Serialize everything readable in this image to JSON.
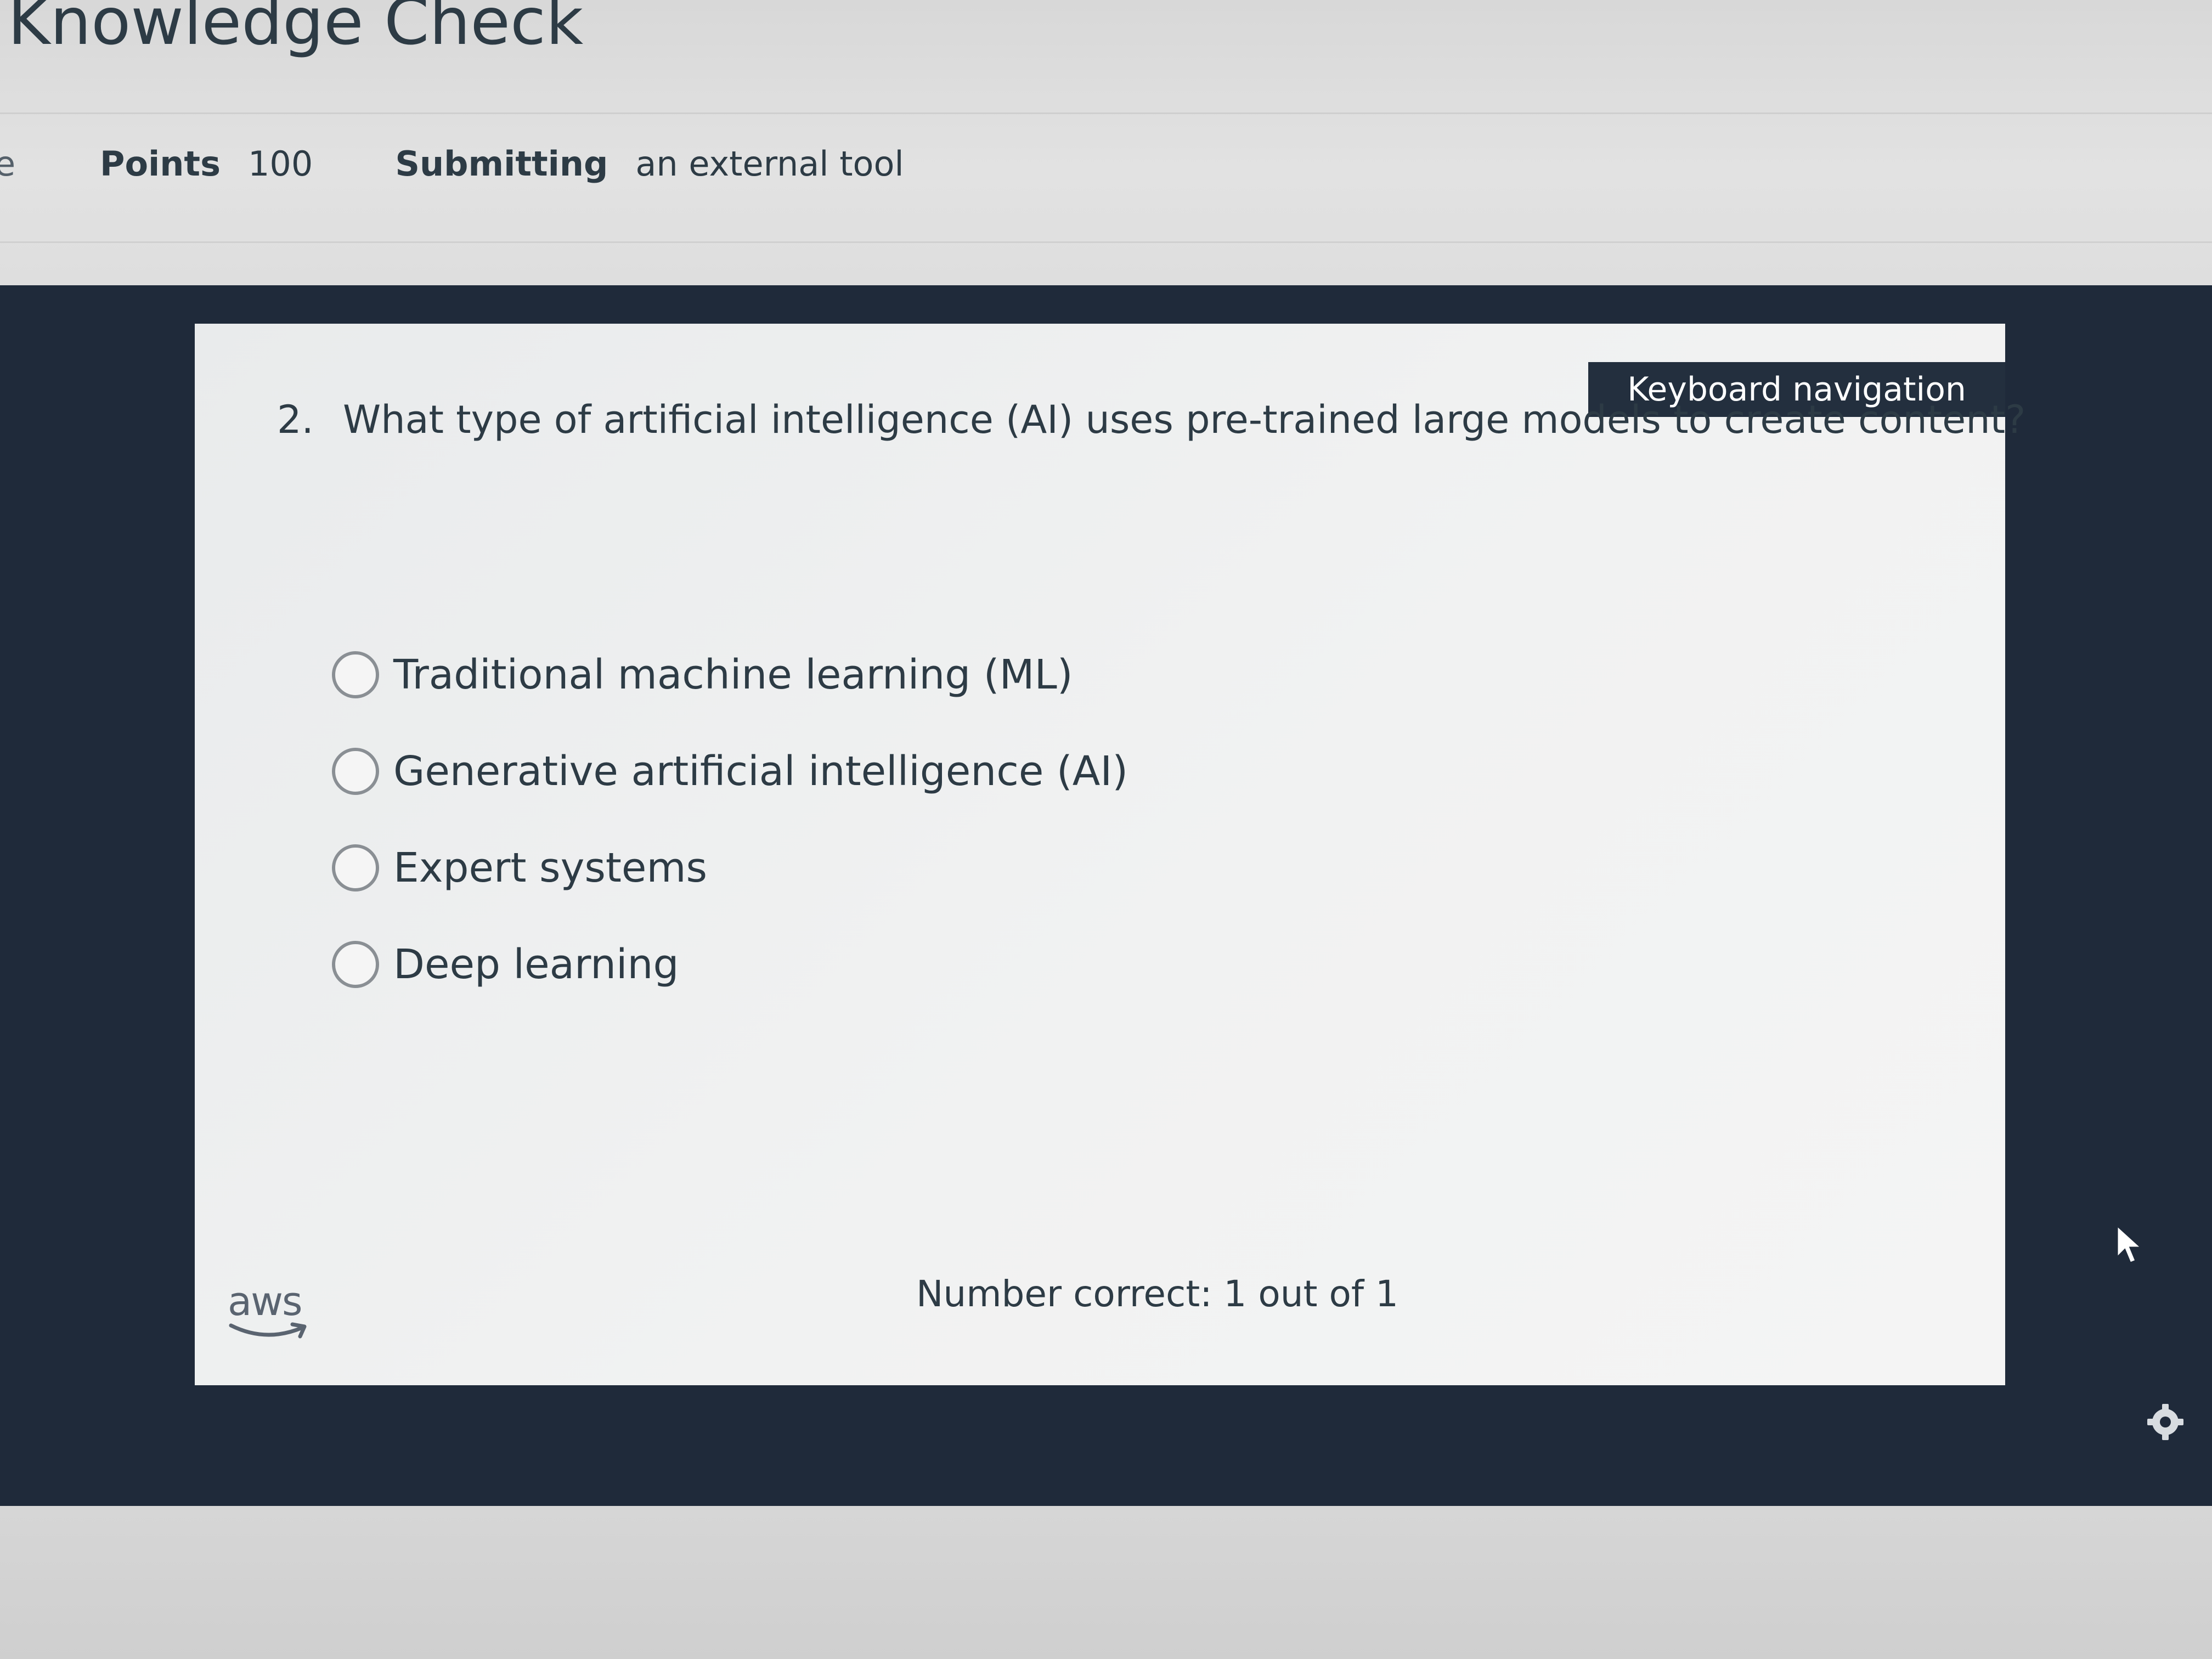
{
  "page": {
    "title": "Knowledge Check",
    "edge_letter": "e",
    "details": {
      "points_label": "Points",
      "points_value": "100",
      "submitting_label": "Submitting",
      "submitting_value": "an external tool"
    }
  },
  "quiz": {
    "keyboard_nav_label": "Keyboard navigation",
    "question_number": "2.",
    "question_text": "What type of artificial intelligence (AI) uses pre-trained large models to create content?",
    "options": [
      "Traditional machine learning (ML)",
      "Generative artificial intelligence (AI)",
      "Expert systems",
      "Deep learning"
    ],
    "score_text": "Number correct: 1 out of 1",
    "logo_text": "aws"
  },
  "icons": {
    "cursor": "mouse-pointer-icon",
    "gear": "gear-icon",
    "radio": "radio-button-icon",
    "logo": "aws-logo-icon"
  },
  "colors": {
    "frame": "#1f2a3a",
    "keyboard_nav_bg": "#232f3e",
    "text": "#2d3b45"
  }
}
